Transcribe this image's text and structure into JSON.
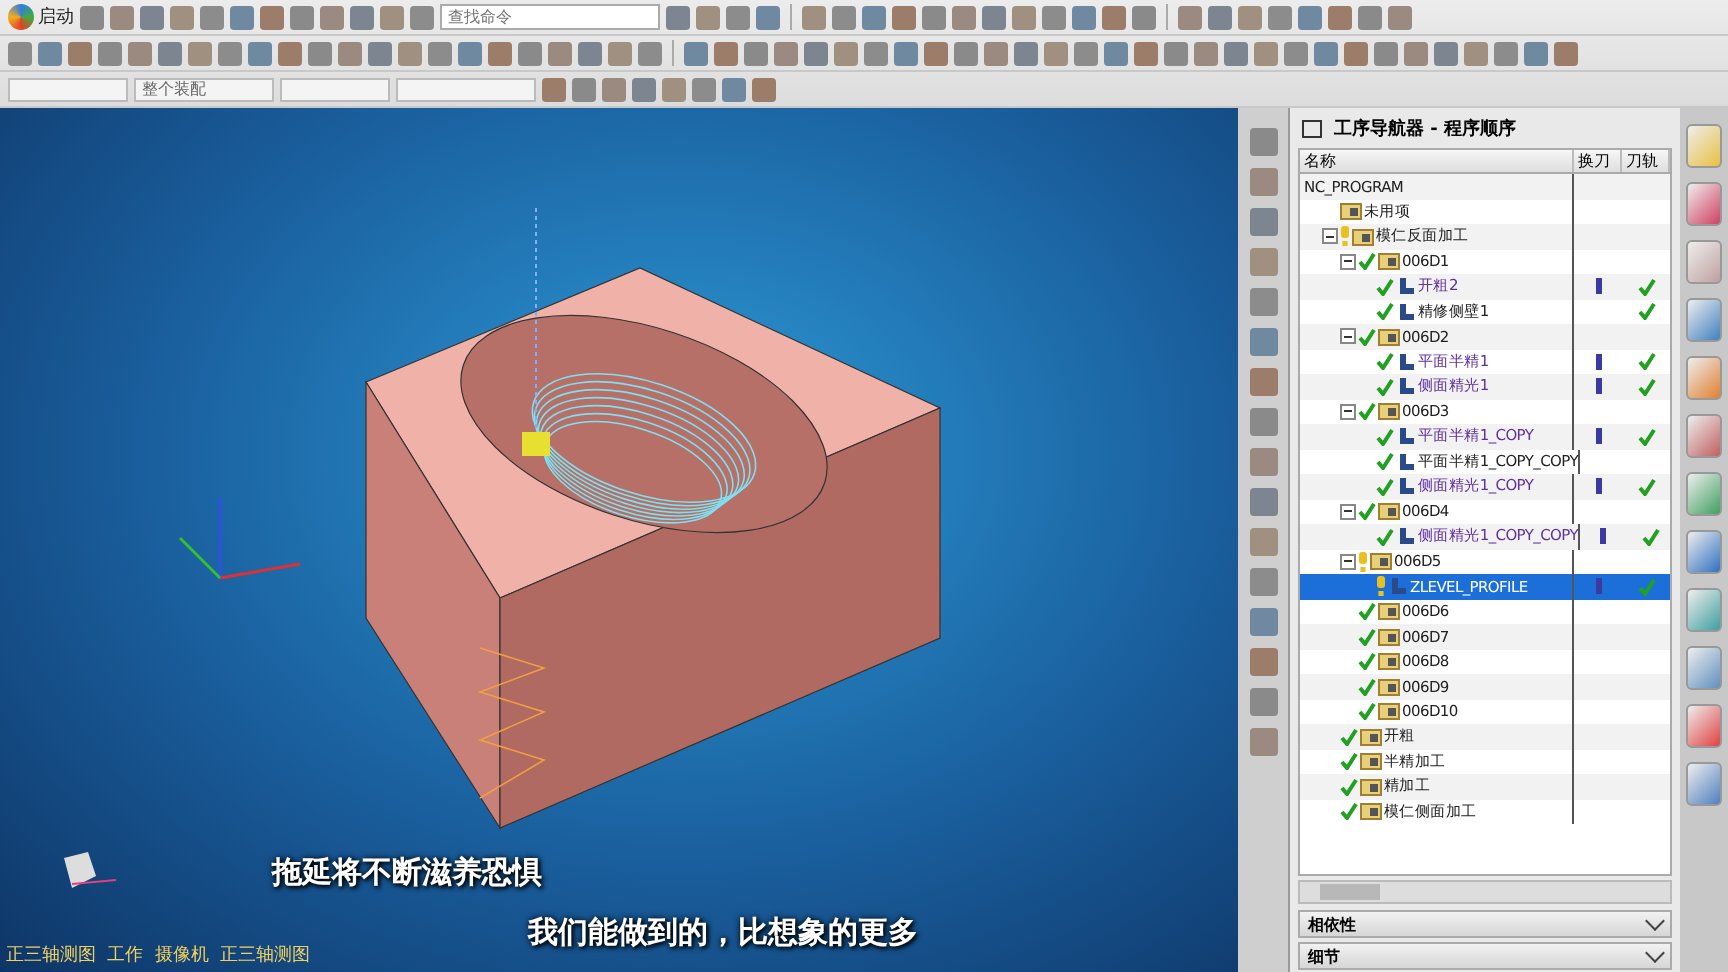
{
  "toolbar": {
    "start_label": "启动",
    "search": {
      "placeholder": "查找命令"
    },
    "selection_filter": {
      "value": "整个装配"
    }
  },
  "viewport": {
    "status_text": "正三轴测图  工作  摄像机  正三轴测图",
    "subtitles": [
      "拖延将不断滋养恐惧",
      "我们能做到的，比想象的更多"
    ]
  },
  "navigator": {
    "title": "工序导航器 - 程序顺序",
    "columns": [
      "名称",
      "换刀",
      "刀轨"
    ],
    "tree": [
      {
        "label": "NC_PROGRAM",
        "children": [
          {
            "label": "未用项",
            "kind": "group",
            "complete": false,
            "warning": false
          },
          {
            "label": "模仁反面加工",
            "kind": "group",
            "complete": false,
            "warning": true,
            "expanded": true,
            "children": [
              {
                "label": "006D1",
                "kind": "group",
                "complete": true,
                "warning": false,
                "expanded": true,
                "children": [
                  {
                    "label": "开粗2",
                    "kind": "operation",
                    "complete": true,
                    "warning": false,
                    "tool_change": true,
                    "toolpath": true,
                    "selected": false
                  },
                  {
                    "label": "精修侧壁1",
                    "kind": "operation",
                    "complete": true,
                    "warning": false,
                    "tool_change": false,
                    "toolpath": true,
                    "selected": false
                  }
                ]
              },
              {
                "label": "006D2",
                "kind": "group",
                "complete": true,
                "warning": false,
                "expanded": true,
                "children": [
                  {
                    "label": "平面半精1",
                    "kind": "operation",
                    "complete": true,
                    "warning": false,
                    "tool_change": true,
                    "toolpath": true,
                    "selected": false
                  },
                  {
                    "label": "侧面精光1",
                    "kind": "operation",
                    "complete": true,
                    "warning": false,
                    "tool_change": true,
                    "toolpath": true,
                    "selected": false
                  }
                ]
              },
              {
                "label": "006D3",
                "kind": "group",
                "complete": true,
                "warning": false,
                "expanded": true,
                "children": [
                  {
                    "label": "平面半精1_COPY",
                    "kind": "operation",
                    "complete": true,
                    "warning": false,
                    "tool_change": true,
                    "toolpath": true,
                    "selected": false
                  },
                  {
                    "label": "平面半精1_COPY_COPY",
                    "kind": "operation",
                    "complete": true,
                    "warning": false,
                    "tool_change": false,
                    "toolpath": false,
                    "selected": false
                  },
                  {
                    "label": "侧面精光1_COPY",
                    "kind": "operation",
                    "complete": true,
                    "warning": false,
                    "tool_change": true,
                    "toolpath": true,
                    "selected": false
                  }
                ]
              },
              {
                "label": "006D4",
                "kind": "group",
                "complete": true,
                "warning": false,
                "expanded": true,
                "children": [
                  {
                    "label": "侧面精光1_COPY_COPY",
                    "kind": "operation",
                    "complete": true,
                    "warning": false,
                    "tool_change": true,
                    "toolpath": true,
                    "selected": false
                  }
                ]
              },
              {
                "label": "006D5",
                "kind": "group",
                "complete": false,
                "warning": true,
                "expanded": true,
                "children": [
                  {
                    "label": "ZLEVEL_PROFILE",
                    "kind": "operation",
                    "complete": false,
                    "warning": true,
                    "tool_change": true,
                    "toolpath": true,
                    "selected": true
                  }
                ]
              },
              {
                "label": "006D6",
                "kind": "group",
                "complete": true,
                "warning": false
              },
              {
                "label": "006D7",
                "kind": "group",
                "complete": true,
                "warning": false
              },
              {
                "label": "006D8",
                "kind": "group",
                "complete": true,
                "warning": false
              },
              {
                "label": "006D9",
                "kind": "group",
                "complete": true,
                "warning": false
              },
              {
                "label": "006D10",
                "kind": "group",
                "complete": true,
                "warning": false
              }
            ]
          },
          {
            "label": "开粗",
            "kind": "group",
            "complete": true,
            "warning": false
          },
          {
            "label": "半精加工",
            "kind": "group",
            "complete": true,
            "warning": false
          },
          {
            "label": "精加工",
            "kind": "group",
            "complete": true,
            "warning": false
          },
          {
            "label": "模仁侧面加工",
            "kind": "group",
            "complete": true,
            "warning": false
          }
        ]
      }
    ],
    "panels": [
      {
        "label": "相依性",
        "expanded": false
      },
      {
        "label": "细节",
        "expanded": false
      }
    ]
  }
}
